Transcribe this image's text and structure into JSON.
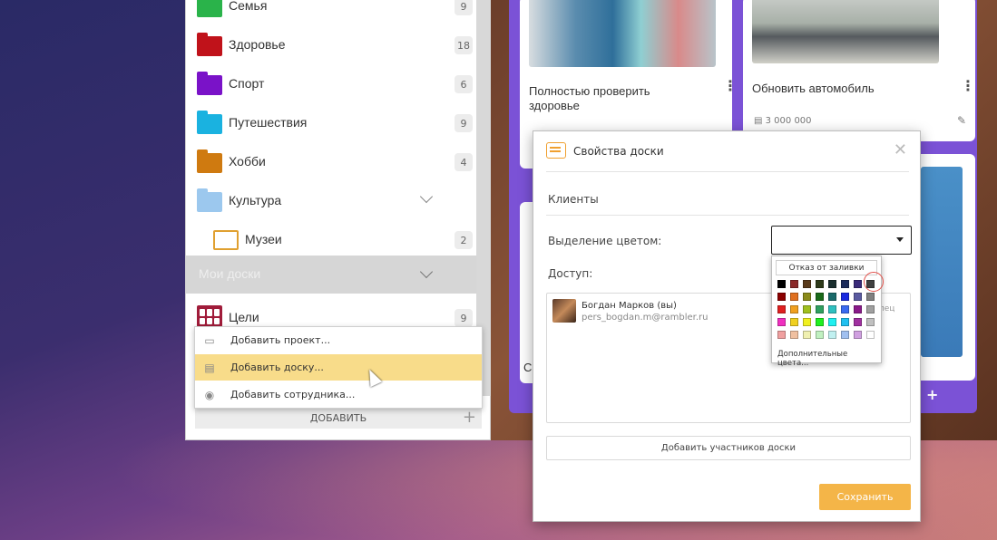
{
  "sidebar": {
    "categories": [
      {
        "label": "Семья",
        "count": "9",
        "color": "#2ab34a"
      },
      {
        "label": "Здоровье",
        "count": "18",
        "color": "#c0121a"
      },
      {
        "label": "Спорт",
        "count": "6",
        "color": "#7a12c8"
      },
      {
        "label": "Путешествия",
        "count": "9",
        "color": "#1ab2e0"
      },
      {
        "label": "Хобби",
        "count": "4",
        "color": "#cf7a10"
      },
      {
        "label": "Культура",
        "count": "",
        "color": "#9cc8ee"
      }
    ],
    "subfolder": {
      "label": "Музеи",
      "count": "2",
      "color": "#e0a030"
    },
    "my_boards_label": "Мои доски",
    "goals": {
      "label": "Цели",
      "count": "9",
      "color": "#a01c3a"
    },
    "add_label": "ДОБАВИТЬ",
    "add_plus": "+"
  },
  "popup_menu": {
    "items": [
      {
        "label": "Добавить проект...",
        "icon": "folder-open-icon"
      },
      {
        "label": "Добавить доску...",
        "icon": "board-icon"
      },
      {
        "label": "Добавить сотрудника...",
        "icon": "user-icon"
      }
    ]
  },
  "boards": {
    "card1_title": "Полностью проверить здоровье",
    "card2_title": "Обновить автомобиль",
    "card2_meta": "3 000 000",
    "kebab": "⋮",
    "plus": "+",
    "partial_letter": "С"
  },
  "dialog": {
    "title": "Свойства доски",
    "close": "✕",
    "board_name": "Клиенты",
    "color_label": "Выделение цветом:",
    "access_label": "Доступ:",
    "member_name": "Богдан Марков (вы)",
    "member_email": "pers_bogdan.m@rambler.ru",
    "partial_text": "лец",
    "add_members": "Добавить участников доски",
    "save": "Сохранить"
  },
  "palette": {
    "no_fill": "Отказ от заливки",
    "more_colors": "Дополнительные цвета...",
    "colors": [
      "#000000",
      "#8b2a2a",
      "#5a3a1a",
      "#2e3a1a",
      "#1a2e2e",
      "#1a2a5a",
      "#3a2a7a",
      "#404040",
      "#8b0000",
      "#e07020",
      "#8b8b1a",
      "#1a6a1a",
      "#1a6a6a",
      "#1a2ae0",
      "#5a5aa0",
      "#808080",
      "#e02020",
      "#f0a020",
      "#a0c020",
      "#30a060",
      "#30c0c0",
      "#3a6af0",
      "#8a1a8a",
      "#a0a0a0",
      "#f030c0",
      "#f0d020",
      "#f0f020",
      "#20f020",
      "#20f0f0",
      "#20c0f0",
      "#a030a0",
      "#c0c0c0",
      "#f0a0a0",
      "#f0c0a0",
      "#f0f0b0",
      "#c0f0c0",
      "#c0f0f0",
      "#a0c0f0",
      "#d0a0e0",
      "#ffffff"
    ]
  }
}
